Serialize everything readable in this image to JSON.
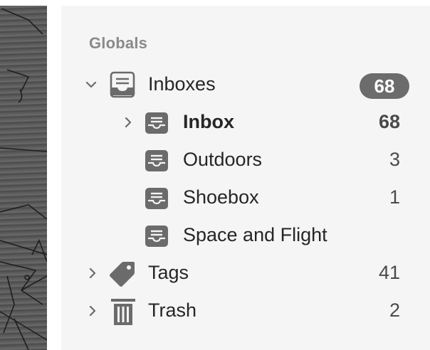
{
  "sidebar": {
    "section_title": "Globals",
    "items": [
      {
        "label": "Inboxes",
        "count": "68",
        "icon": "tray-stack-icon",
        "expanded": true
      },
      {
        "label": "Inbox",
        "count": "68",
        "icon": "tray-icon",
        "expanded": false
      },
      {
        "label": "Outdoors",
        "count": "3",
        "icon": "tray-icon"
      },
      {
        "label": "Shoebox",
        "count": "1",
        "icon": "tray-icon"
      },
      {
        "label": "Space and Flight",
        "count": "",
        "icon": "tray-icon"
      },
      {
        "label": "Tags",
        "count": "41",
        "icon": "tag-icon",
        "expanded": false
      },
      {
        "label": "Trash",
        "count": "2",
        "icon": "trash-icon",
        "expanded": false
      }
    ]
  },
  "colors": {
    "sidebar_background": "#f5f5f5",
    "badge_background": "#6c6c6c",
    "icon_gray": "#6b6b6b",
    "header_gray": "#8a8a8a"
  }
}
